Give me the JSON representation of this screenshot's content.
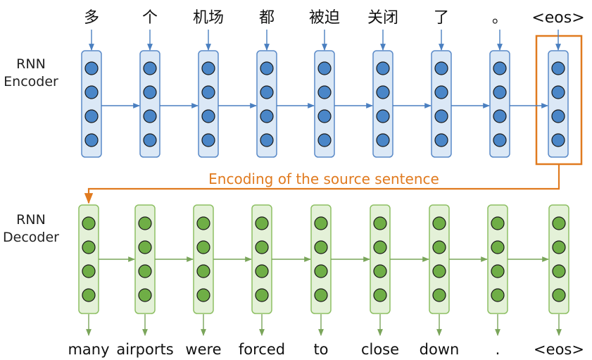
{
  "encoder": {
    "label_line1": "RNN",
    "label_line2": "Encoder",
    "tokens": [
      "多",
      "个",
      "机场",
      "都",
      "被迫",
      "关闭",
      "了",
      "。",
      "<eos>"
    ]
  },
  "decoder": {
    "label_line1": "RNN",
    "label_line2": "Decoder",
    "tokens": [
      "many",
      "airports",
      "were",
      "forced",
      "to",
      "close",
      "down",
      ".",
      "<eos>"
    ]
  },
  "encoding_caption": "Encoding of the source sentence",
  "colors": {
    "encoder_cell_fill": "#dbe8f6",
    "encoder_cell_stroke": "#5a8ac8",
    "encoder_node": "#4a86c8",
    "decoder_cell_fill": "#e4f1d8",
    "decoder_cell_stroke": "#8dbf63",
    "decoder_node": "#6fae46",
    "arrow_blue": "#4a7fc0",
    "arrow_green": "#7aa55a",
    "highlight": "#e07a1f"
  },
  "nodes_per_cell": 4
}
